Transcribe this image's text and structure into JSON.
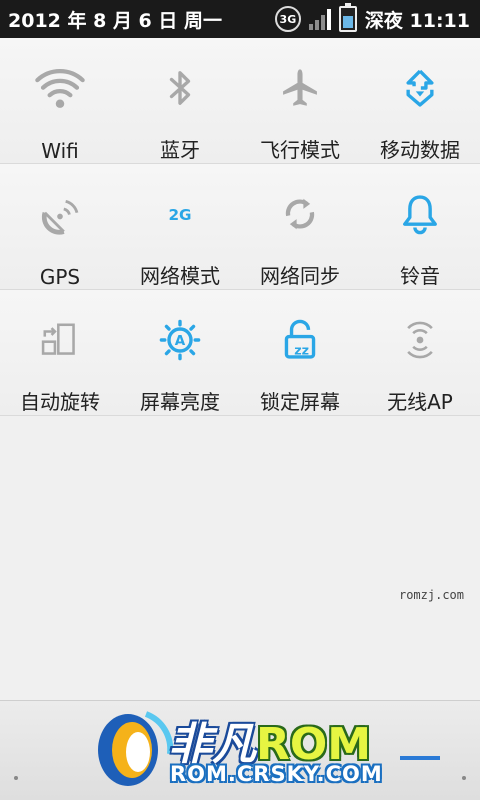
{
  "statusbar": {
    "date": "2012 年 8 月 6 日 周一",
    "network": "3G",
    "time_label": "深夜 11:11"
  },
  "tiles": [
    [
      {
        "label": "Wifi",
        "icon": "wifi-icon",
        "active": false
      },
      {
        "label": "蓝牙",
        "icon": "bluetooth-icon",
        "active": false
      },
      {
        "label": "飞行模式",
        "icon": "airplane-icon",
        "active": false
      },
      {
        "label": "移动数据",
        "icon": "mobile-data-icon",
        "active": true
      }
    ],
    [
      {
        "label": "GPS",
        "icon": "gps-icon",
        "active": false
      },
      {
        "label": "网络模式",
        "icon": "network-mode-2g-icon",
        "active": true,
        "icon_text": "2G"
      },
      {
        "label": "网络同步",
        "icon": "sync-icon",
        "active": false
      },
      {
        "label": "铃音",
        "icon": "bell-icon",
        "active": true
      }
    ],
    [
      {
        "label": "自动旋转",
        "icon": "auto-rotate-icon",
        "active": false
      },
      {
        "label": "屏幕亮度",
        "icon": "brightness-auto-icon",
        "active": true,
        "icon_text": "A"
      },
      {
        "label": "锁定屏幕",
        "icon": "lock-screen-icon",
        "active": true,
        "icon_text": "zz"
      },
      {
        "label": "无线AP",
        "icon": "wireless-ap-icon",
        "active": false
      }
    ]
  ],
  "watermark": "romzj.com",
  "logo": {
    "main": "非凡",
    "rom": "ROM",
    "sub": "ROM.CRSKY.COM"
  },
  "colors": {
    "active": "#2aa6e6",
    "inactive": "#a8a8a8",
    "statusbar": "#1a1a1a"
  }
}
